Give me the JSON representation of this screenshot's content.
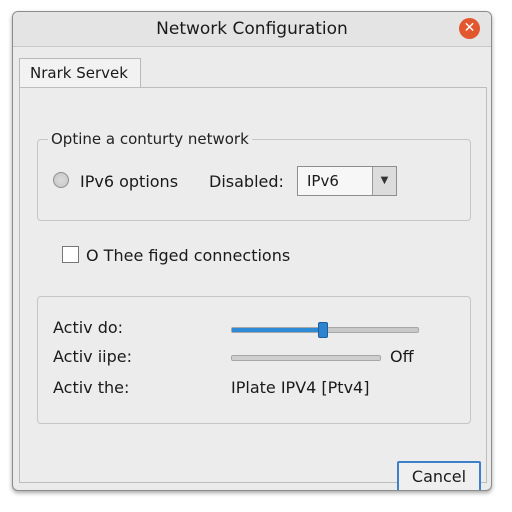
{
  "window": {
    "title": "Network Configuration",
    "close_glyph": "✕"
  },
  "tab": {
    "label": "Nrark Servek"
  },
  "group1": {
    "label": "Optine a conturty network",
    "radio_label": "IPv6 options",
    "disabled_label": "Disabled:",
    "select_value": "IPv6",
    "select_arrow": "▼"
  },
  "checkbox": {
    "label": "O Thee figed connections",
    "checked": false
  },
  "group2": {
    "rows": [
      {
        "label": "Activ do:"
      },
      {
        "label": "Activ iipe:"
      },
      {
        "label": "Activ the:"
      }
    ],
    "slider_level": 0.49,
    "toggle_state": "Off",
    "ip_value": "IPlate IPV4 [Ptv4]"
  },
  "buttons": {
    "cancel": "Cancel"
  },
  "colors": {
    "accent": "#2e8ad6",
    "close": "#e2572e"
  }
}
